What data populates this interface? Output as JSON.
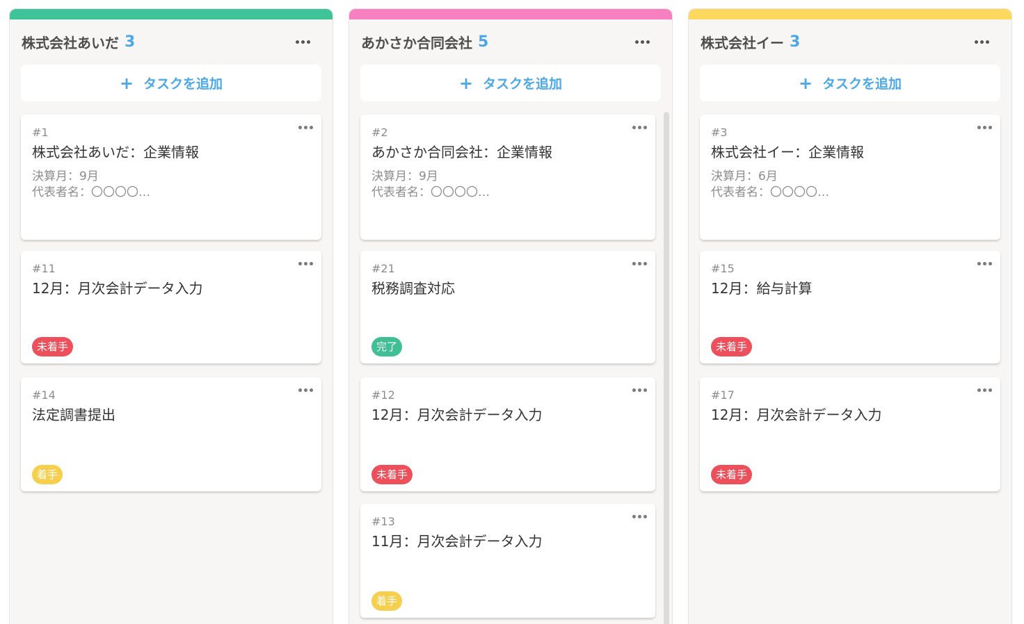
{
  "colors": {
    "column1_accent": "#3fc49a",
    "column2_accent": "#f87fc0",
    "column3_accent": "#fdd85e",
    "count": "#4ba8e6",
    "status_not_started": "#ed4f5b",
    "status_in_progress": "#f6cf4e",
    "status_done": "#3fbf93"
  },
  "columns": [
    {
      "title": "株式会社あいだ",
      "count": "3",
      "add_label": "タスクを追加",
      "cards": [
        {
          "number": "#1",
          "title": "株式会社あいだ：企業情報",
          "desc_line1": "決算月：9月",
          "desc_line2": "代表者名：〇〇〇〇…",
          "status": ""
        },
        {
          "number": "#11",
          "title": "12月：月次会計データ入力",
          "status": "未着手"
        },
        {
          "number": "#14",
          "title": "法定調書提出",
          "status": "着手"
        }
      ]
    },
    {
      "title": "あかさか合同会社",
      "count": "5",
      "add_label": "タスクを追加",
      "cards": [
        {
          "number": "#2",
          "title": "あかさか合同会社：企業情報",
          "desc_line1": "決算月：9月",
          "desc_line2": "代表者名：〇〇〇〇…",
          "status": ""
        },
        {
          "number": "#21",
          "title": "税務調査対応",
          "status": "完了"
        },
        {
          "number": "#12",
          "title": "12月：月次会計データ入力",
          "status": "未着手"
        },
        {
          "number": "#13",
          "title": "11月：月次会計データ入力",
          "status": "着手"
        }
      ]
    },
    {
      "title": "株式会社イー",
      "count": "3",
      "add_label": "タスクを追加",
      "cards": [
        {
          "number": "#3",
          "title": "株式会社イー：企業情報",
          "desc_line1": "決算月：6月",
          "desc_line2": "代表者名：〇〇〇〇…",
          "status": ""
        },
        {
          "number": "#15",
          "title": "12月：給与計算",
          "status": "未着手"
        },
        {
          "number": "#17",
          "title": "12月：月次会計データ入力",
          "status": "未着手"
        }
      ]
    }
  ]
}
